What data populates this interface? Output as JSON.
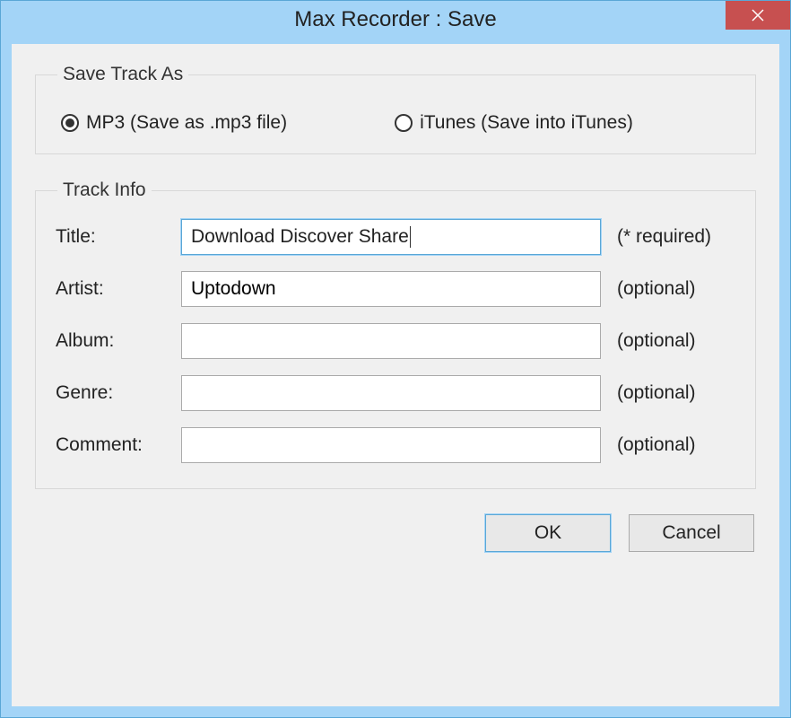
{
  "window": {
    "title": "Max Recorder : Save"
  },
  "groups": {
    "save_as": {
      "legend": "Save Track As",
      "options": {
        "mp3": {
          "label": "MP3 (Save as .mp3 file)",
          "selected": true
        },
        "itunes": {
          "label": "iTunes (Save into iTunes)",
          "selected": false
        }
      }
    },
    "track_info": {
      "legend": "Track Info",
      "fields": {
        "title": {
          "label": "Title:",
          "value": "Download Discover Share",
          "hint": "(* required)"
        },
        "artist": {
          "label": "Artist:",
          "value": "Uptodown",
          "hint": "(optional)"
        },
        "album": {
          "label": "Album:",
          "value": "",
          "hint": "(optional)"
        },
        "genre": {
          "label": "Genre:",
          "value": "",
          "hint": "(optional)"
        },
        "comment": {
          "label": "Comment:",
          "value": "",
          "hint": "(optional)"
        }
      }
    }
  },
  "buttons": {
    "ok": "OK",
    "cancel": "Cancel"
  }
}
